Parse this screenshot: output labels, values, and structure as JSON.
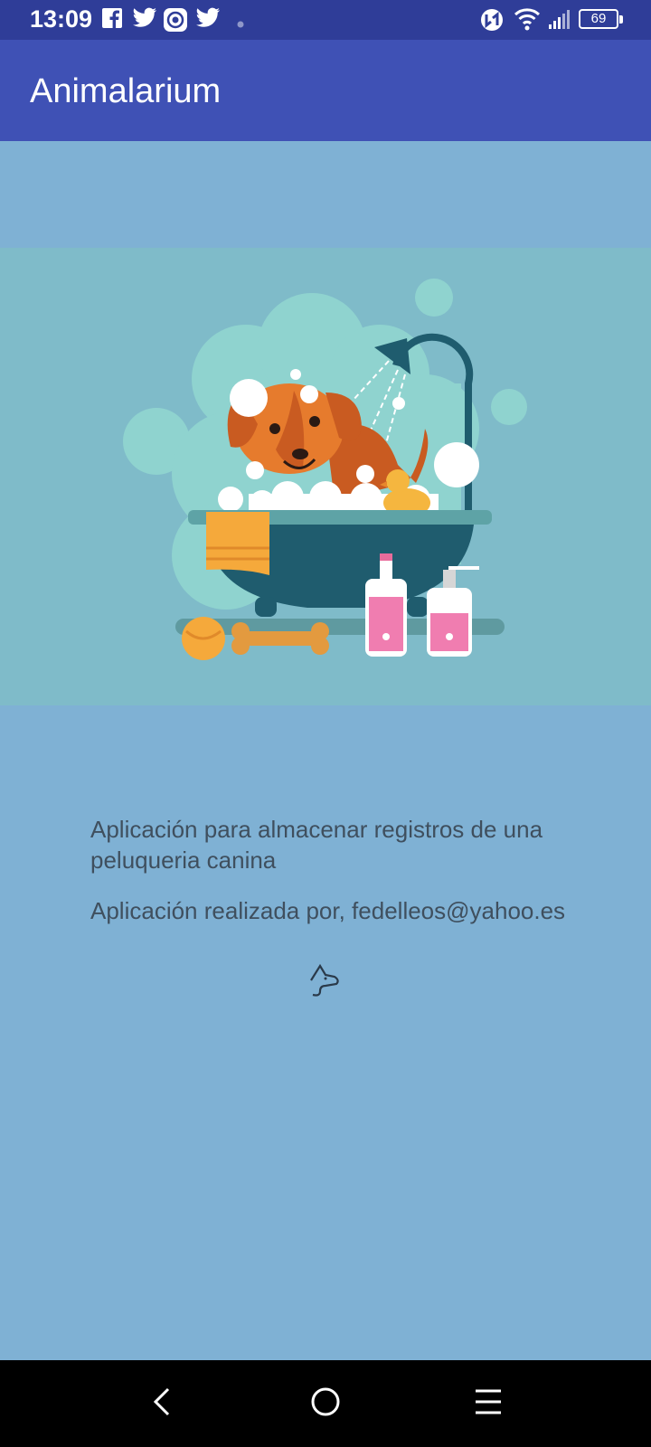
{
  "status_bar": {
    "time": "13:09",
    "left_icons": [
      "facebook-icon",
      "twitter-icon",
      "app-notification-icon",
      "twitter-icon",
      "more-notifications-dot"
    ],
    "right_icons": [
      "nfc-icon",
      "wifi-icon",
      "signal-icon",
      "battery-icon"
    ],
    "battery_level": "69"
  },
  "app_bar": {
    "title": "Animalarium",
    "background": "#3f51b5"
  },
  "hero": {
    "description": "dog-bath-illustration",
    "background": "#7fbbc9"
  },
  "content": {
    "line1": "Aplicación para almacenar registros de una peluqueria canina",
    "line2": "Aplicación realizada por, fedelleos@yahoo.es",
    "text_color": "#3f4f5e"
  },
  "nav_bar": {
    "buttons": [
      "back-icon",
      "home-icon",
      "recents-icon"
    ]
  },
  "colors": {
    "page_background": "#7fb1d4",
    "status_bar": "#2f3d98"
  }
}
